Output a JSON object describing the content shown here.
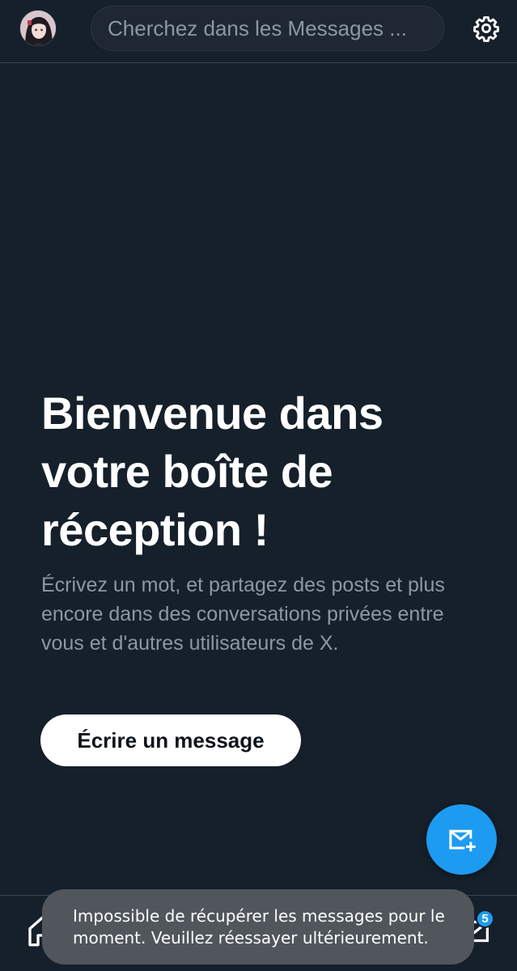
{
  "header": {
    "search_placeholder": "Cherchez dans les Messages ...",
    "avatar_icon": "user-avatar",
    "settings_icon": "gear-icon"
  },
  "welcome": {
    "title_line1": "Bienvenue dans",
    "title_line2": "votre boîte de",
    "title_line3": "réception !",
    "description": "Écrivez un mot, et partagez des posts et plus encore dans des conversations privées entre vous et d'autres utilisateurs de X.",
    "write_button_label": "Écrire un message"
  },
  "fab": {
    "icon": "new-message-icon"
  },
  "bottom_nav": {
    "home_icon": "home-icon",
    "messages_icon": "mail-icon",
    "messages_badge": "5"
  },
  "toast": {
    "line1": "Impossible de récupérer les messages pour le",
    "line2": "moment. Veuillez réessayer ultérieurement."
  },
  "colors": {
    "background": "#15202b",
    "accent": "#1d9bf0",
    "muted_text": "#8b98a5",
    "toast_bg": "#50565c"
  }
}
